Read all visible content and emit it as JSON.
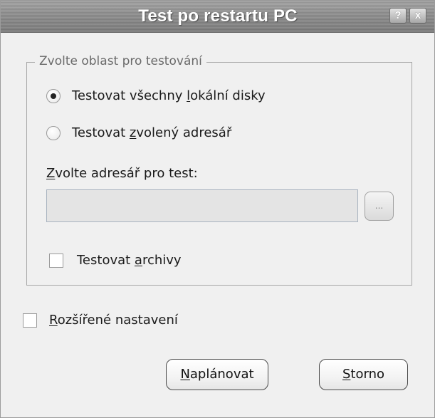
{
  "window": {
    "title": "Test po restartu PC",
    "help_glyph": "?",
    "close_glyph": "x"
  },
  "group": {
    "legend": "Zvolte oblast pro testování",
    "radio_all": {
      "pre": "Testovat všechny ",
      "ul": "l",
      "post": "okální disky",
      "checked": true
    },
    "radio_selected": {
      "pre": "Testovat ",
      "ul": "z",
      "post": "volený adresář",
      "checked": false
    },
    "dir_label": {
      "pre": "",
      "ul": "Z",
      "post": "volte adresář pro test:"
    },
    "dir_input": {
      "value": "",
      "disabled": true
    },
    "browse_label": "...",
    "archives": {
      "pre": "Testovat ",
      "ul": "a",
      "post": "rchivy",
      "checked": false
    }
  },
  "advanced": {
    "pre": "",
    "ul": "R",
    "post": "ozšířené nastavení",
    "checked": false
  },
  "buttons": {
    "schedule": {
      "pre": "",
      "ul": "N",
      "post": "aplánovat"
    },
    "cancel": {
      "pre": "",
      "ul": "S",
      "post": "torno"
    }
  }
}
